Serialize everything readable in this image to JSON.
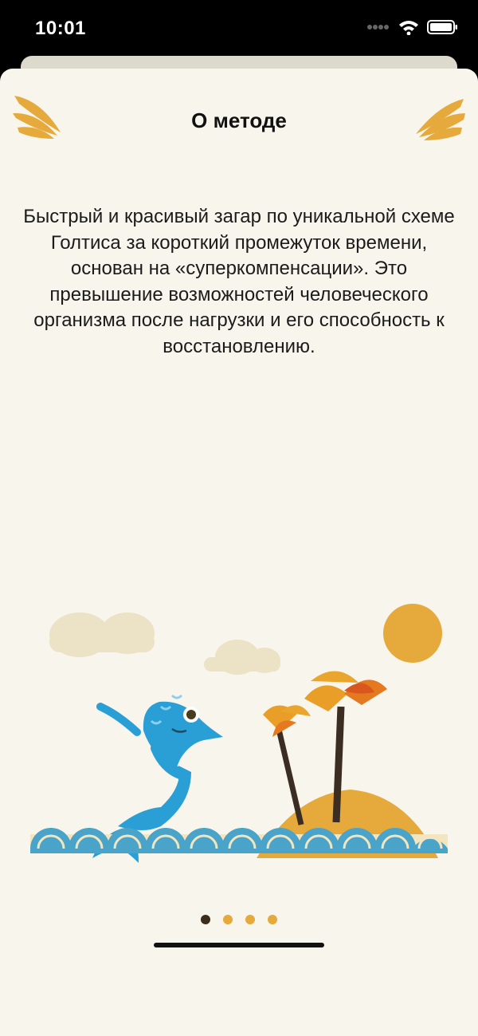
{
  "status_bar": {
    "time": "10:01"
  },
  "screen": {
    "title": "О методе",
    "description": "Быстрый и красивый загар по уникальной схеме Голтиса за короткий промежуток времени, основан на «суперкомпенсации». Это превышение возможностей человеческого организма после нагрузки и его способность к восстановлению."
  },
  "pager": {
    "total": 4,
    "active_index": 0
  },
  "colors": {
    "background": "#f8f5ec",
    "accent": "#e6a93b",
    "active_dot": "#3a2d1b",
    "dolphin": "#2a9fd6",
    "sea": "#4aa3c9"
  }
}
